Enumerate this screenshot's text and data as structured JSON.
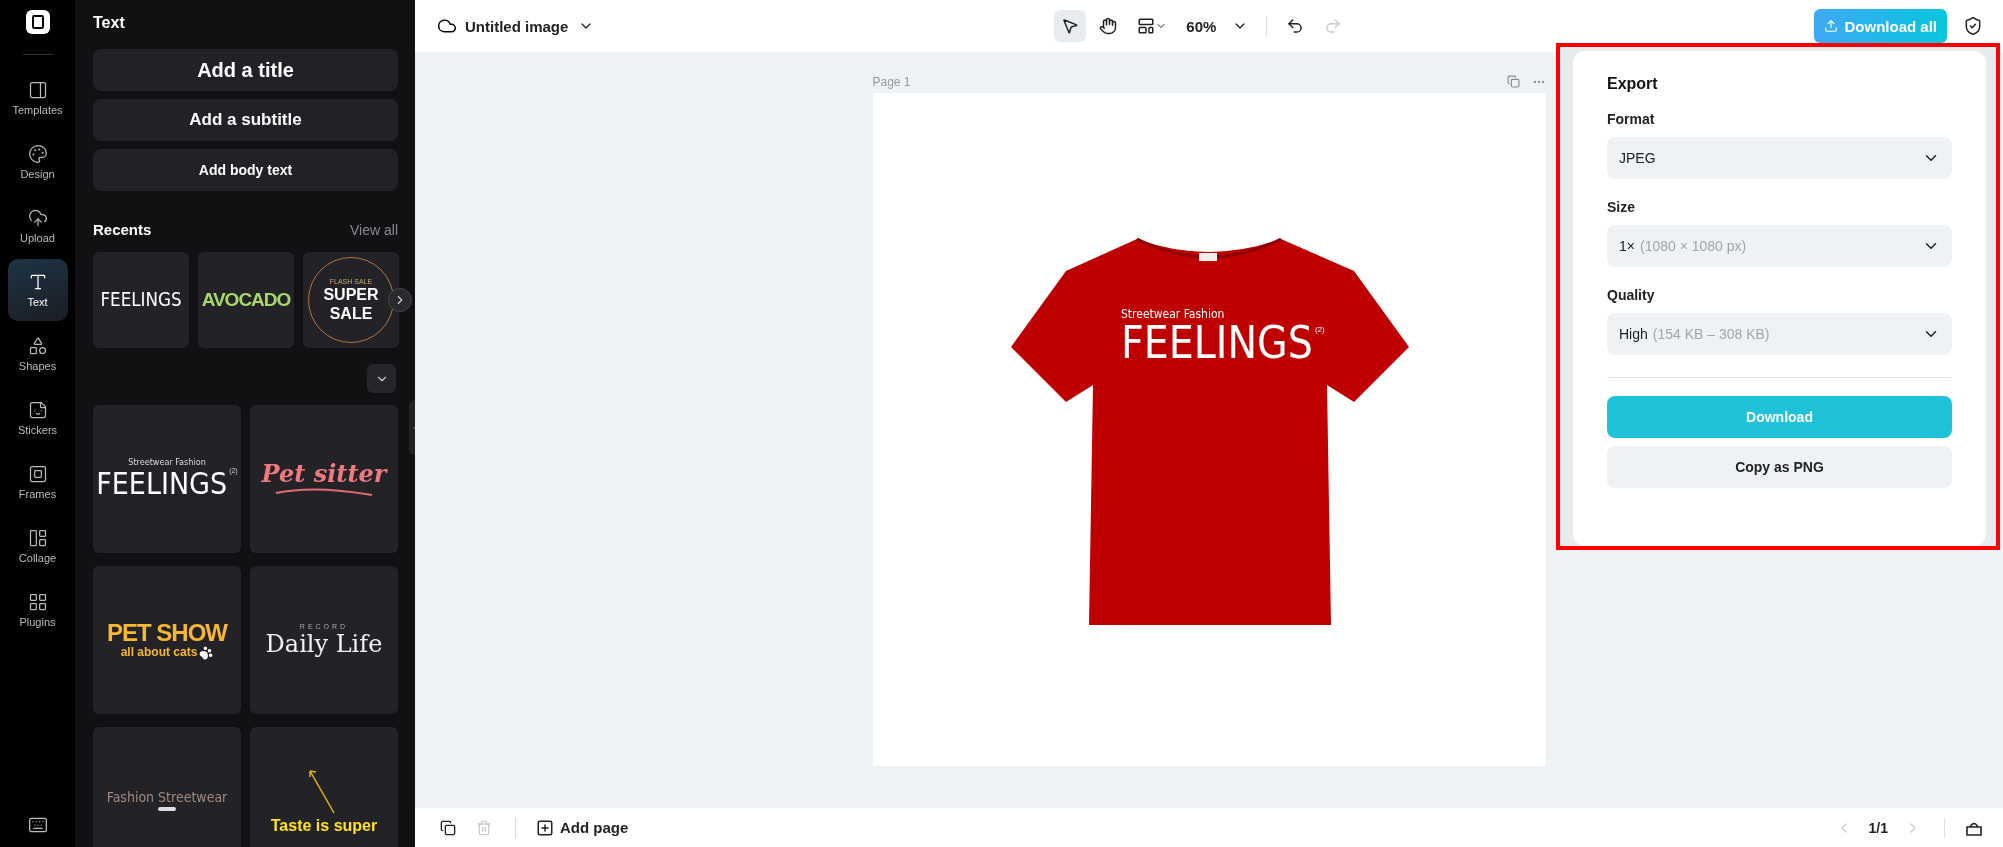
{
  "rail": {
    "items": [
      {
        "kind": "templates",
        "label": "Templates",
        "selected": false
      },
      {
        "kind": "design",
        "label": "Design",
        "selected": false
      },
      {
        "kind": "upload",
        "label": "Upload",
        "selected": false
      },
      {
        "kind": "text",
        "label": "Text",
        "selected": true
      },
      {
        "kind": "shapes",
        "label": "Shapes",
        "selected": false
      },
      {
        "kind": "stickers",
        "label": "Stickers",
        "selected": false
      },
      {
        "kind": "frames",
        "label": "Frames",
        "selected": false
      },
      {
        "kind": "collage",
        "label": "Collage",
        "selected": false
      },
      {
        "kind": "plugins",
        "label": "Plugins",
        "selected": false
      }
    ]
  },
  "panel": {
    "title": "Text",
    "add_buttons": [
      "Add a title",
      "Add a subtitle",
      "Add body text"
    ],
    "recents_title": "Recents",
    "view_all": "View all",
    "recents": [
      {
        "kind": "feelings",
        "main": "FEELINGS"
      },
      {
        "kind": "avocado",
        "main": "AVOCADO"
      },
      {
        "kind": "sale",
        "top": "FLASH SALE",
        "main": "SUPER",
        "sub": "SALE"
      }
    ],
    "templates": [
      {
        "kind": "feelings",
        "top": "Streetwear Fashion",
        "main": "FEELINGS",
        "mark": "(2)"
      },
      {
        "kind": "petsitter",
        "main": "Pet sitter"
      },
      {
        "kind": "petshow",
        "main": "PET SHOW",
        "sub": "all about cats"
      },
      {
        "kind": "daily",
        "top": "RECORD",
        "main": "Daily Life"
      },
      {
        "kind": "fashion",
        "main": "Fashion Streetwear"
      },
      {
        "kind": "taste",
        "main": "Taste is super"
      }
    ]
  },
  "topbar": {
    "file_name": "Untitled image",
    "tools": [
      {
        "kind": "pointer",
        "selected": true
      },
      {
        "kind": "hand",
        "selected": false
      }
    ],
    "zoom": "60%",
    "history": [
      {
        "kind": "undo",
        "disabled": false
      },
      {
        "kind": "redo",
        "disabled": true
      }
    ],
    "download_all": "Download all"
  },
  "canvas": {
    "page_label": "Page 1",
    "design": {
      "top": "Streetwear Fashion",
      "main": "FEELINGS",
      "mark": "(2)"
    }
  },
  "export": {
    "title": "Export",
    "fields": [
      {
        "label": "Format",
        "value": "JPEG"
      },
      {
        "label": "Size",
        "value": "1×",
        "detail": "(1080 × 1080 px)"
      },
      {
        "label": "Quality",
        "value": "High",
        "detail": "(154 KB – 308 KB)"
      }
    ],
    "primary": "Download",
    "secondary": "Copy as PNG"
  },
  "bottom": {
    "page_actions": [
      {
        "kind": "duplicate",
        "disabled": false
      },
      {
        "kind": "delete",
        "disabled": true
      }
    ],
    "add_page": "Add page",
    "pager": "1/1",
    "nav": [
      {
        "kind": "prev",
        "disabled": true
      },
      {
        "kind": "next",
        "disabled": true
      }
    ]
  }
}
